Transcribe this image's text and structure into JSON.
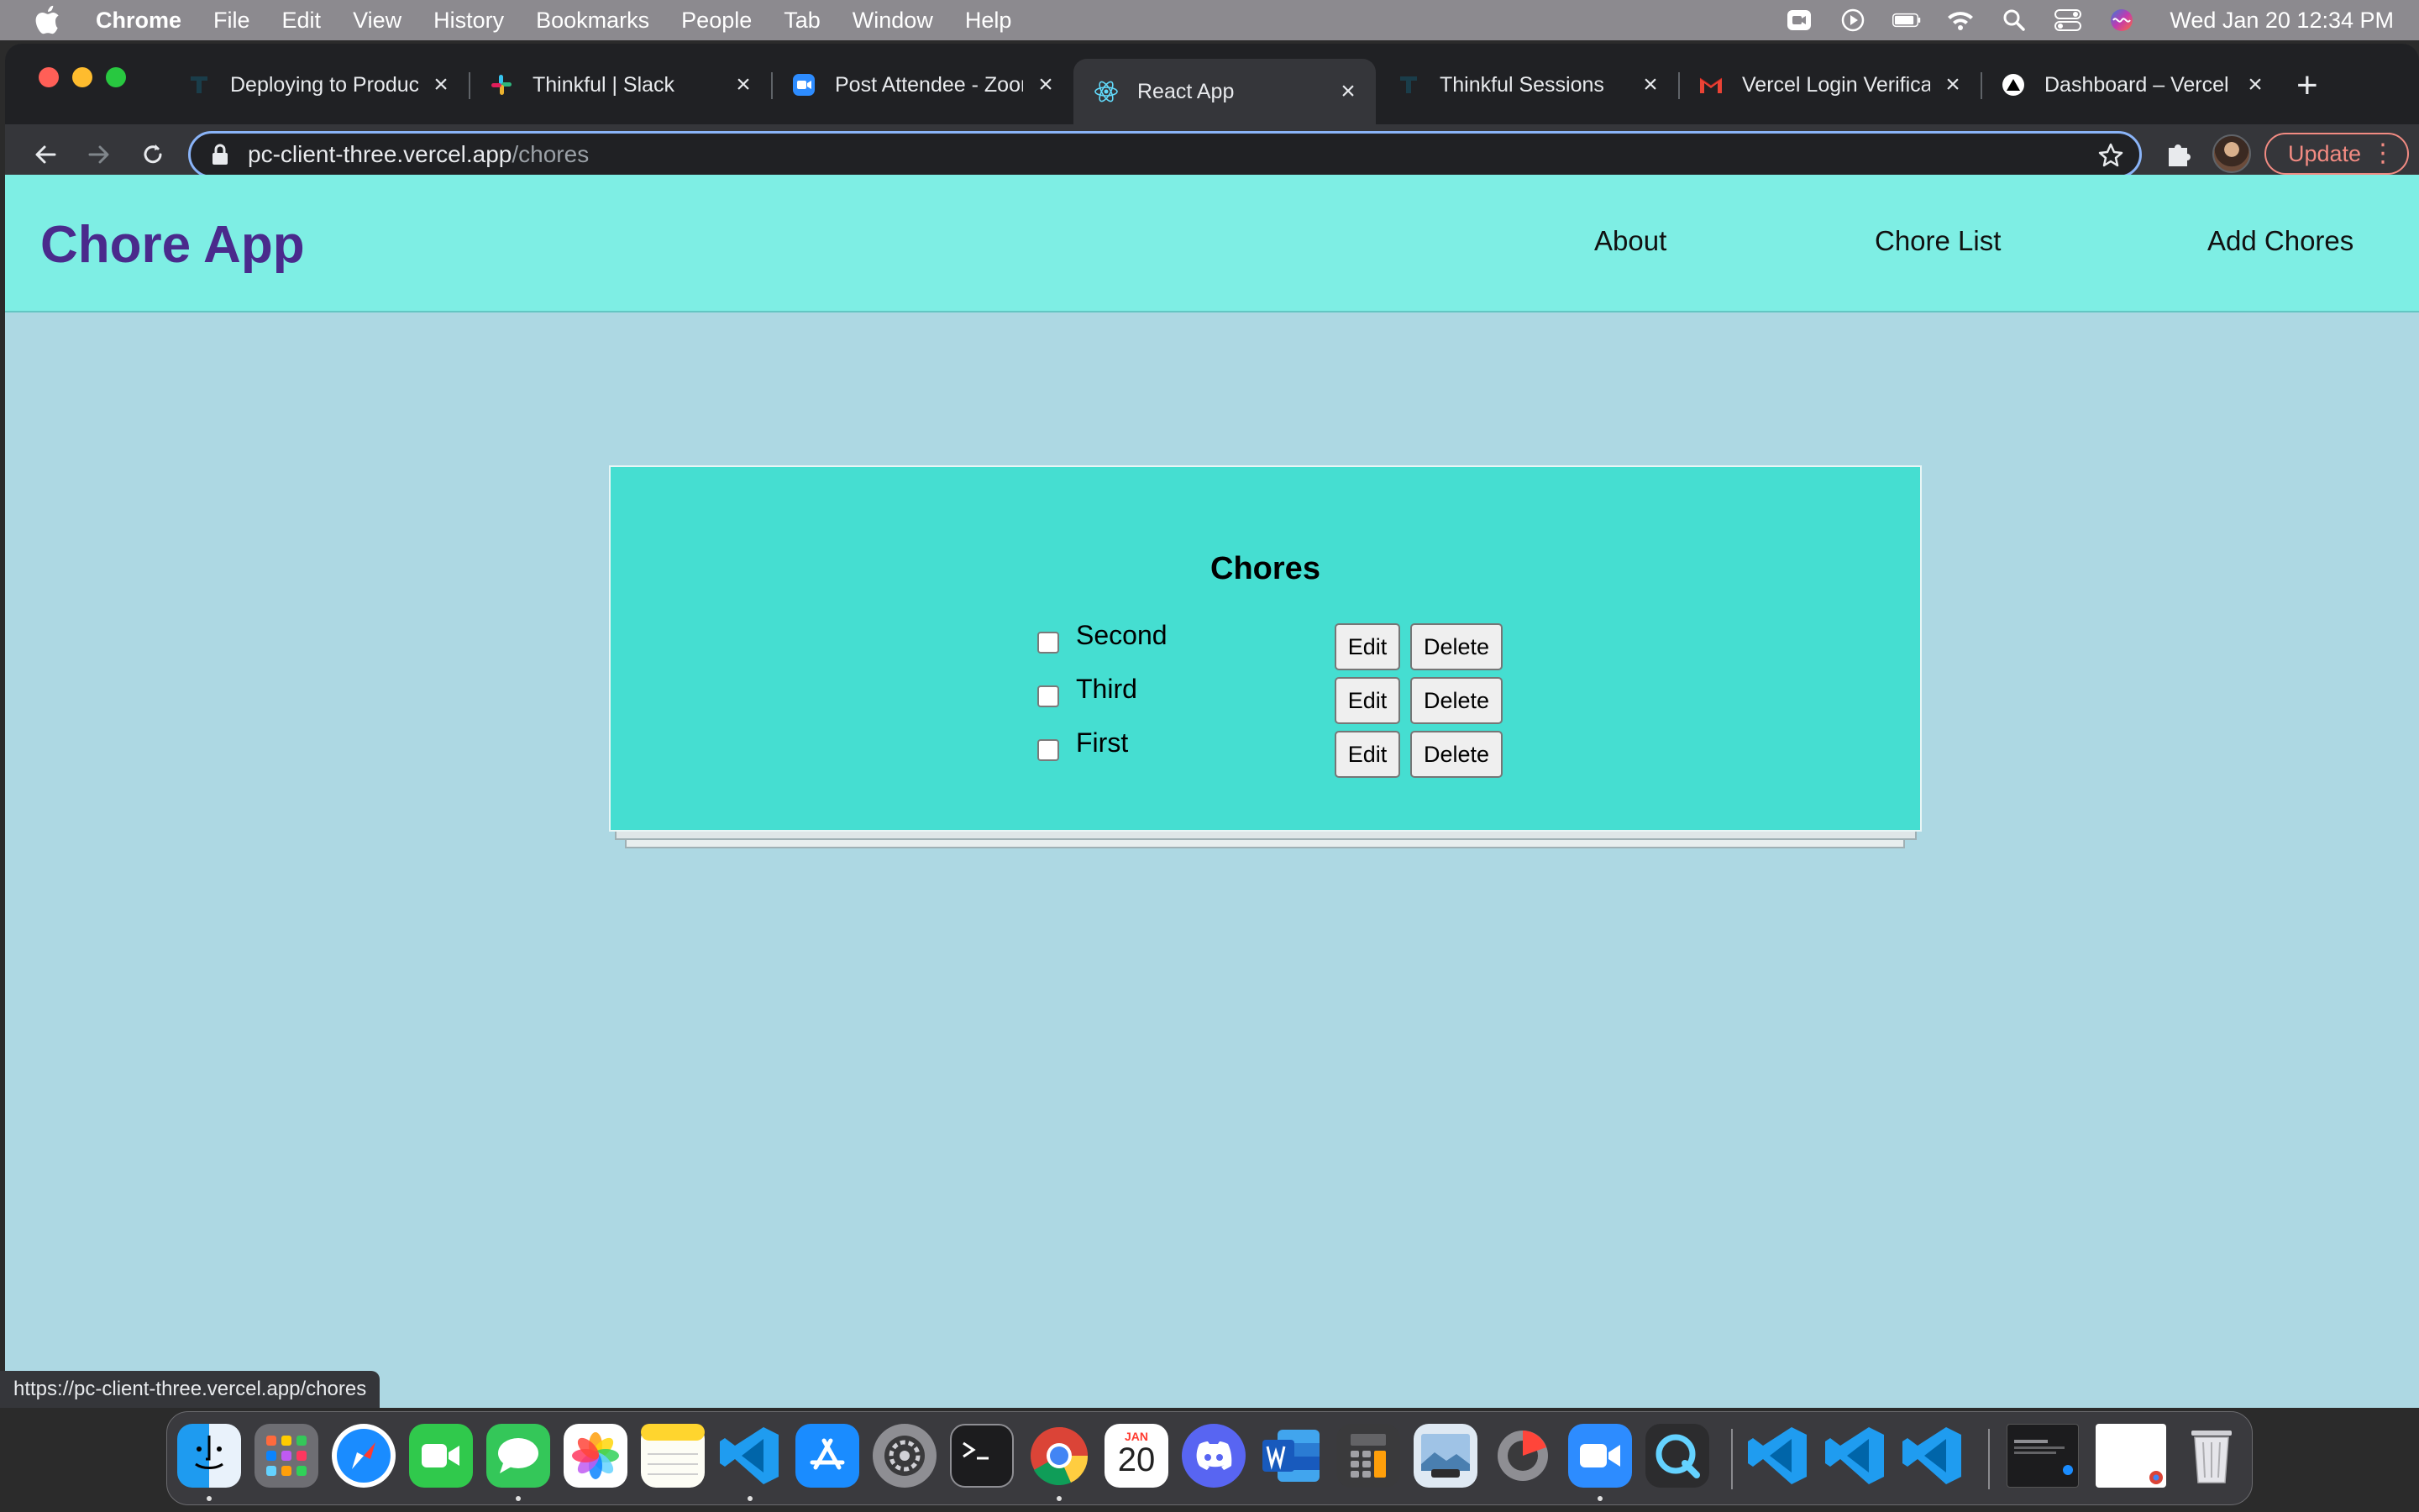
{
  "menubar": {
    "app_name": "Chrome",
    "menus": [
      "File",
      "Edit",
      "View",
      "History",
      "Bookmarks",
      "People",
      "Tab",
      "Window",
      "Help"
    ],
    "clock": "Wed Jan 20  12:34 PM"
  },
  "browser": {
    "tabs": [
      {
        "title": "Deploying to Production",
        "favicon": "thinkful-icon",
        "active": false
      },
      {
        "title": "Thinkful | Slack",
        "favicon": "slack-icon",
        "active": false
      },
      {
        "title": "Post Attendee - Zoom",
        "favicon": "zoom-icon",
        "active": false
      },
      {
        "title": "React App",
        "favicon": "react-icon",
        "active": true
      },
      {
        "title": "Thinkful Sessions",
        "favicon": "thinkful-icon",
        "active": false
      },
      {
        "title": "Vercel Login Verification",
        "favicon": "gmail-icon",
        "active": false
      },
      {
        "title": "Dashboard – Vercel",
        "favicon": "vercel-icon",
        "active": false
      }
    ],
    "url_host": "pc-client-three.vercel.app",
    "url_path": "/chores",
    "update_label": "Update",
    "status_url": "https://pc-client-three.vercel.app/chores"
  },
  "app": {
    "title": "Chore App",
    "nav": [
      "About",
      "Chore List",
      "Add Chores"
    ],
    "colors": {
      "header_bg": "#7eeee4",
      "title": "#4a2a8c",
      "card_bg": "#45ded1",
      "page_bg": "#add8e3"
    }
  },
  "chores": {
    "heading": "Chores",
    "items": [
      {
        "label": "Second",
        "checked": false
      },
      {
        "label": "Third",
        "checked": false
      },
      {
        "label": "First",
        "checked": false
      }
    ],
    "edit_label": "Edit",
    "delete_label": "Delete"
  },
  "dock": {
    "apps": [
      "finder-icon",
      "launchpad-icon",
      "safari-icon",
      "facetime-icon",
      "messages-icon",
      "photos-icon",
      "notes-icon",
      "vscode-icon",
      "app-store-icon",
      "system-preferences-icon",
      "terminal-icon",
      "chrome-icon",
      "calendar-icon",
      "discord-icon",
      "word-icon",
      "calculator-icon",
      "preview-icon",
      "disk-utility-icon",
      "zoom-icon",
      "quicktime-icon",
      "vscode-icon",
      "vscode-icon",
      "vscode-icon",
      "window-thumbnail",
      "window-thumbnail",
      "trash-icon"
    ],
    "calendar_month": "JAN",
    "calendar_day": "20"
  }
}
